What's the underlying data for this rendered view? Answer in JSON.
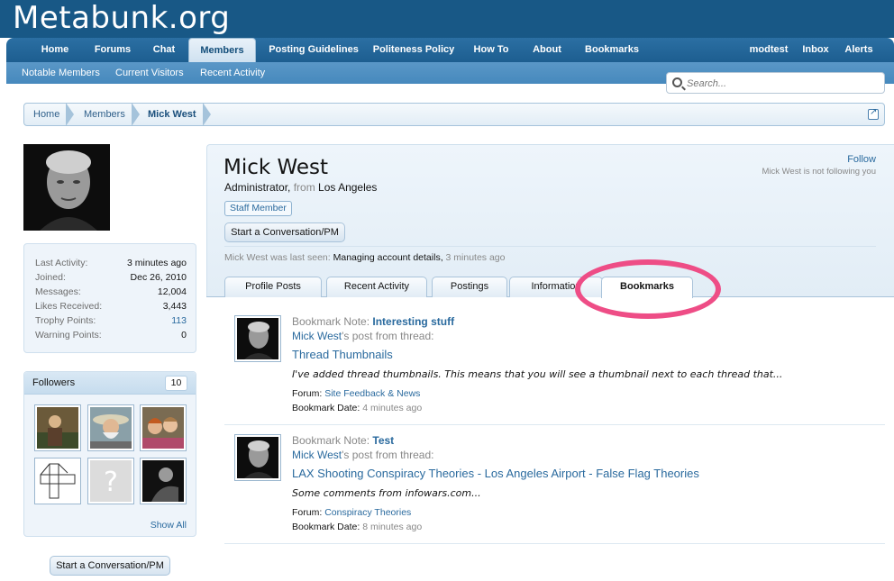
{
  "site": {
    "logo": "Metabunk.org"
  },
  "nav": {
    "tabs": [
      {
        "label": "Home"
      },
      {
        "label": "Forums"
      },
      {
        "label": "Chat"
      },
      {
        "label": "Members"
      },
      {
        "label": "Posting Guidelines"
      },
      {
        "label": "Politeness Policy"
      },
      {
        "label": "How To"
      },
      {
        "label": "About"
      },
      {
        "label": "Bookmarks"
      }
    ],
    "user_links": [
      {
        "label": "modtest"
      },
      {
        "label": "Inbox"
      },
      {
        "label": "Alerts"
      }
    ],
    "subnav": [
      {
        "label": "Notable Members"
      },
      {
        "label": "Current Visitors"
      },
      {
        "label": "Recent Activity"
      }
    ]
  },
  "search": {
    "placeholder": "Search..."
  },
  "breadcrumb": [
    {
      "label": "Home"
    },
    {
      "label": "Members"
    },
    {
      "label": "Mick West"
    }
  ],
  "sidebar": {
    "stats": [
      {
        "label": "Last Activity:",
        "value": "3 minutes ago"
      },
      {
        "label": "Joined:",
        "value": "Dec 26, 2010"
      },
      {
        "label": "Messages:",
        "value": "12,004"
      },
      {
        "label": "Likes Received:",
        "value": "3,443"
      },
      {
        "label": "Trophy Points:",
        "value": "113"
      },
      {
        "label": "Warning Points:",
        "value": "0"
      }
    ],
    "followers": {
      "title": "Followers",
      "count": "10",
      "show_all": "Show All"
    },
    "conversation_button": "Start a Conversation/PM"
  },
  "profile": {
    "name": "Mick West",
    "role": "Administrator,",
    "from_word": "from",
    "location": "Los Angeles",
    "badge": "Staff Member",
    "conversation_button": "Start a Conversation/PM",
    "follow": "Follow",
    "follow_note": "Mick West is not following you",
    "last_seen_prefix": "Mick West was last seen:",
    "last_seen_activity": "Managing account details,",
    "last_seen_time": "3 minutes ago",
    "tabs": [
      {
        "label": "Profile Posts"
      },
      {
        "label": "Recent Activity"
      },
      {
        "label": "Postings"
      },
      {
        "label": "Information"
      },
      {
        "label": "Bookmarks"
      }
    ]
  },
  "bookmarks": [
    {
      "note_label": "Bookmark Note:",
      "note": "Interesting stuff",
      "author": "Mick West",
      "from_text": "'s post from thread:",
      "thread": "Thread Thumbnails",
      "snippet": "I've added thread thumbnails. This means that you will see a thumbnail next to each thread that...",
      "forum_label": "Forum:",
      "forum": "Site Feedback & News",
      "date_label": "Bookmark Date:",
      "date": "4 minutes ago"
    },
    {
      "note_label": "Bookmark Note:",
      "note": "Test",
      "author": "Mick West",
      "from_text": "'s post from thread:",
      "thread": "LAX Shooting Conspiracy Theories - Los Angeles Airport - False Flag Theories",
      "snippet": "Some comments from infowars.com...",
      "forum_label": "Forum:",
      "forum": "Conspiracy Theories",
      "date_label": "Bookmark Date:",
      "date": "8 minutes ago"
    }
  ],
  "colors": {
    "header": "#185886",
    "link": "#2a6a9e",
    "highlight": "#ee4d86"
  }
}
